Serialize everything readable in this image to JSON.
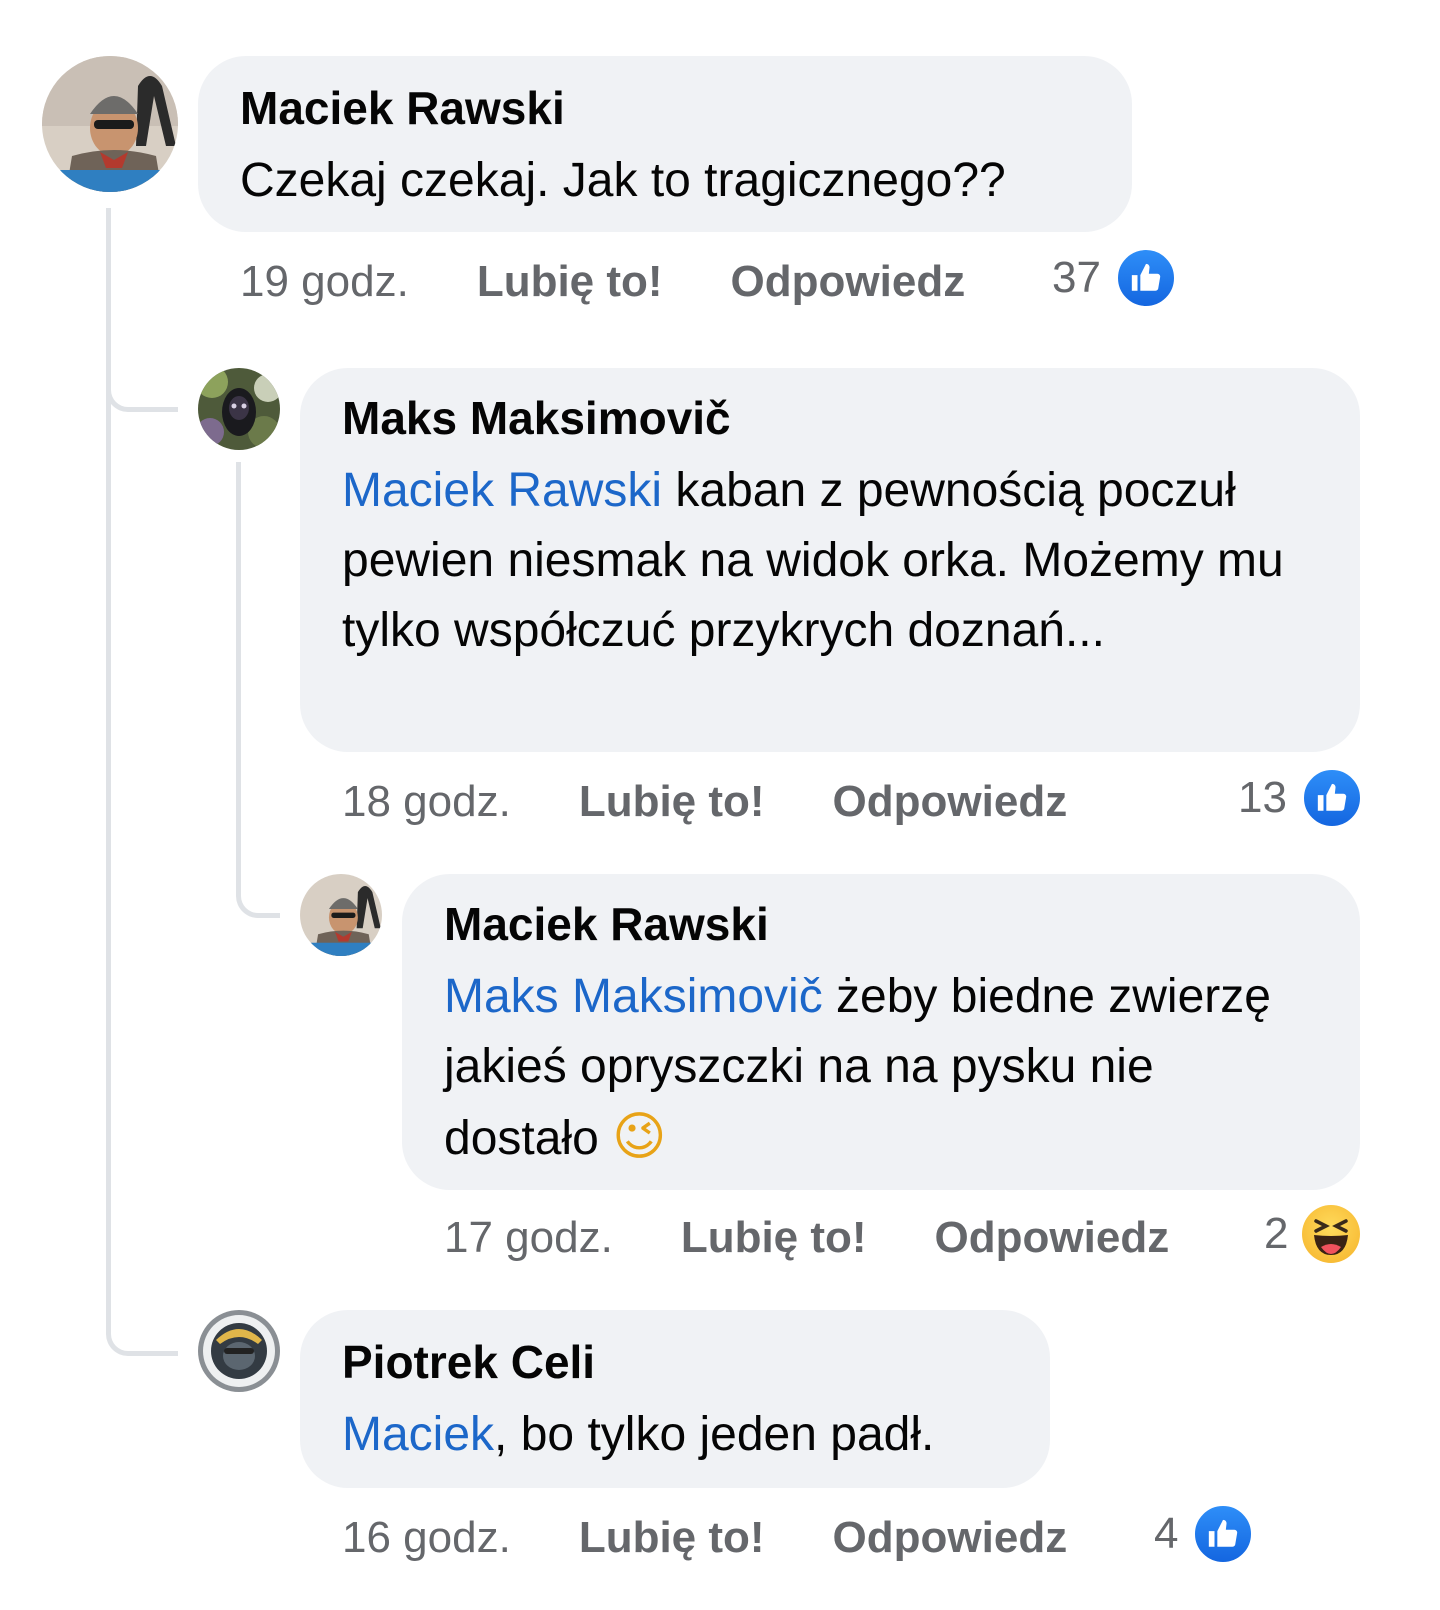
{
  "comments": [
    {
      "author": "Maciek Rawski",
      "text": "Czekaj czekaj. Jak to tragicznego??",
      "time": "19 godz.",
      "like": "Lubię to!",
      "reply": "Odpowiedz",
      "reaction_count": "37",
      "reaction_icon": "like-icon"
    },
    {
      "author": "Maks Maksimovič",
      "mention": "Maciek Rawski",
      "text": " kaban z pewnością poczuł pewien niesmak na widok orka. Możemy mu tylko współczuć przykrych doznań...",
      "time": "18 godz.",
      "like": "Lubię to!",
      "reply": "Odpowiedz",
      "reaction_count": "13",
      "reaction_icon": "like-icon"
    },
    {
      "author": "Maciek Rawski",
      "mention": "Maks Maksimovič",
      "text": " żeby biedne zwierzę jakieś opryszczki na na pysku nie dostało",
      "emoji": "😉",
      "time": "17 godz.",
      "like": "Lubię to!",
      "reply": "Odpowiedz",
      "reaction_count": "2",
      "reaction_icon": "haha-icon"
    },
    {
      "author": "Piotrek Celi",
      "mention": "Maciek",
      "text": ", bo tylko jeden padł.",
      "time": "16 godz.",
      "like": "Lubię to!",
      "reply": "Odpowiedz",
      "reaction_count": "4",
      "reaction_icon": "like-icon"
    }
  ],
  "colors": {
    "bubble": "#f0f2f5",
    "mention": "#1c67c9",
    "meta": "#65676b",
    "like_badge": "#1877f2"
  }
}
